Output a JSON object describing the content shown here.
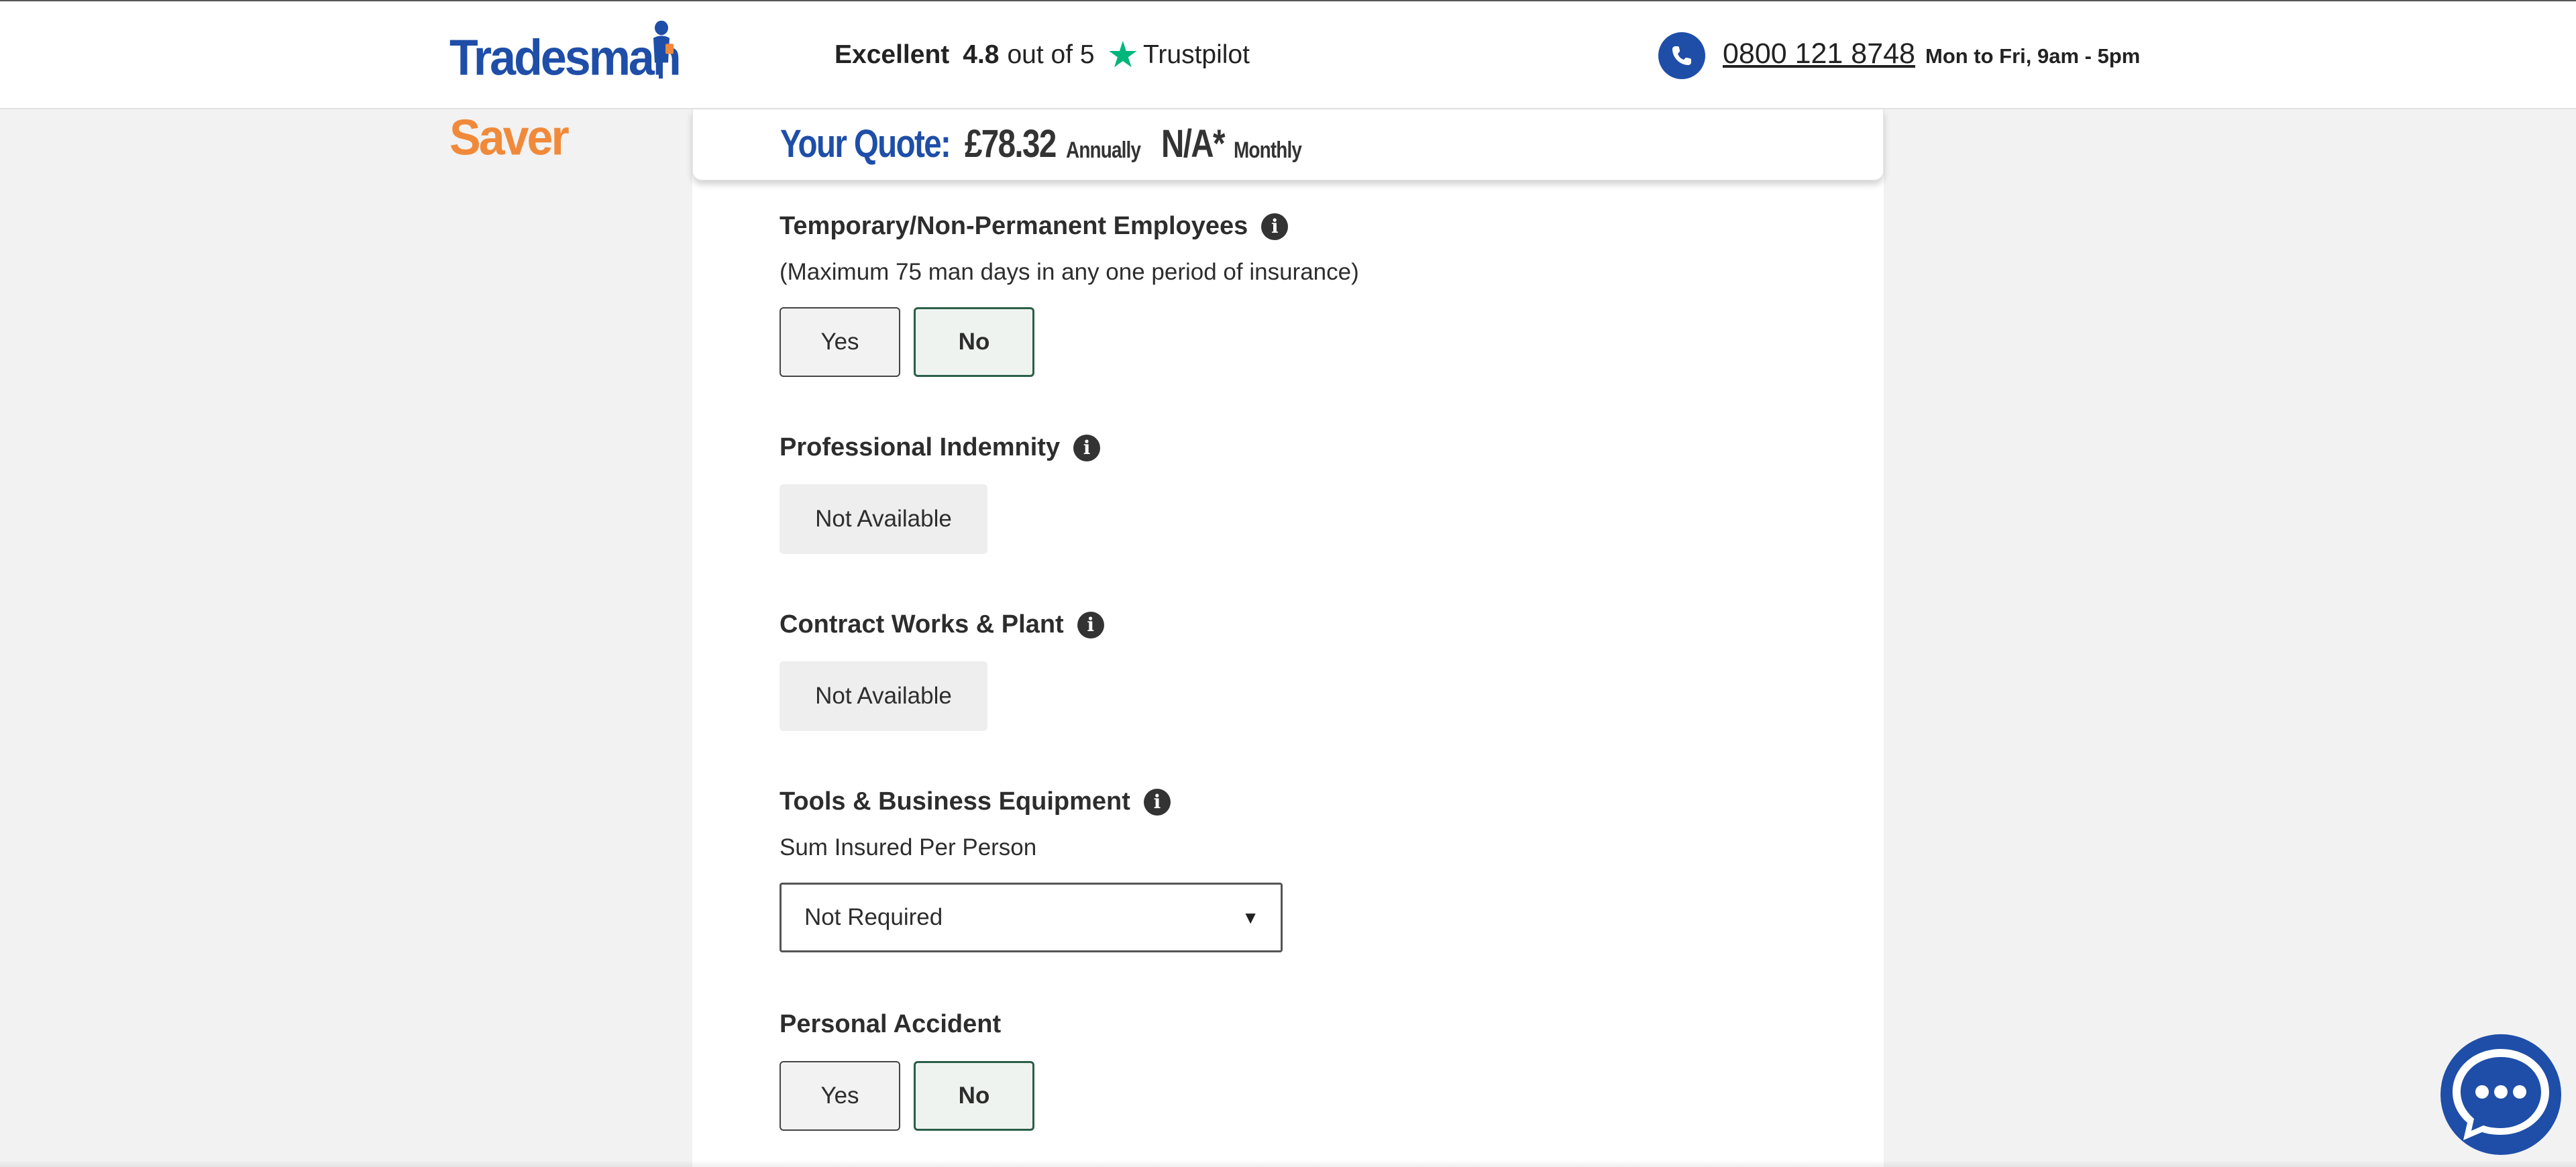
{
  "header": {
    "logo_part1": "Tradesman",
    "logo_part2": "Saver",
    "rating_label": "Excellent",
    "rating_score": "4.8",
    "rating_outof": "out of 5",
    "trustpilot": "Trustpilot",
    "phone_number": "0800 121 8748",
    "hours": "Mon to Fri, 9am - 5pm"
  },
  "quote": {
    "label": "Your Quote:",
    "annual_amount": "£78.32",
    "annual_label": "Annually",
    "monthly_amount": "N/A*",
    "monthly_label": "Monthly"
  },
  "sections": {
    "temp_employees": {
      "title": "Temporary/Non-Permanent Employees",
      "subtext": "(Maximum 75 man days in any one period of insurance)",
      "yes": "Yes",
      "no": "No",
      "selected": "No"
    },
    "professional_indemnity": {
      "title": "Professional Indemnity",
      "value": "Not Available"
    },
    "contract_works": {
      "title": "Contract Works & Plant",
      "value": "Not Available"
    },
    "tools": {
      "title": "Tools & Business Equipment",
      "subtext": "Sum Insured Per Person",
      "selected_option": "Not Required"
    },
    "personal_accident": {
      "title": "Personal Accident",
      "yes": "Yes",
      "no": "No",
      "selected": "No"
    }
  },
  "icons": {
    "info": "i",
    "star": "★",
    "dropdown_arrow": "▼"
  },
  "colors": {
    "brand_blue": "#1e4ea8",
    "brand_orange": "#f08a3a",
    "trustpilot_green": "#00b67a",
    "selected_border": "#2c5e47"
  }
}
